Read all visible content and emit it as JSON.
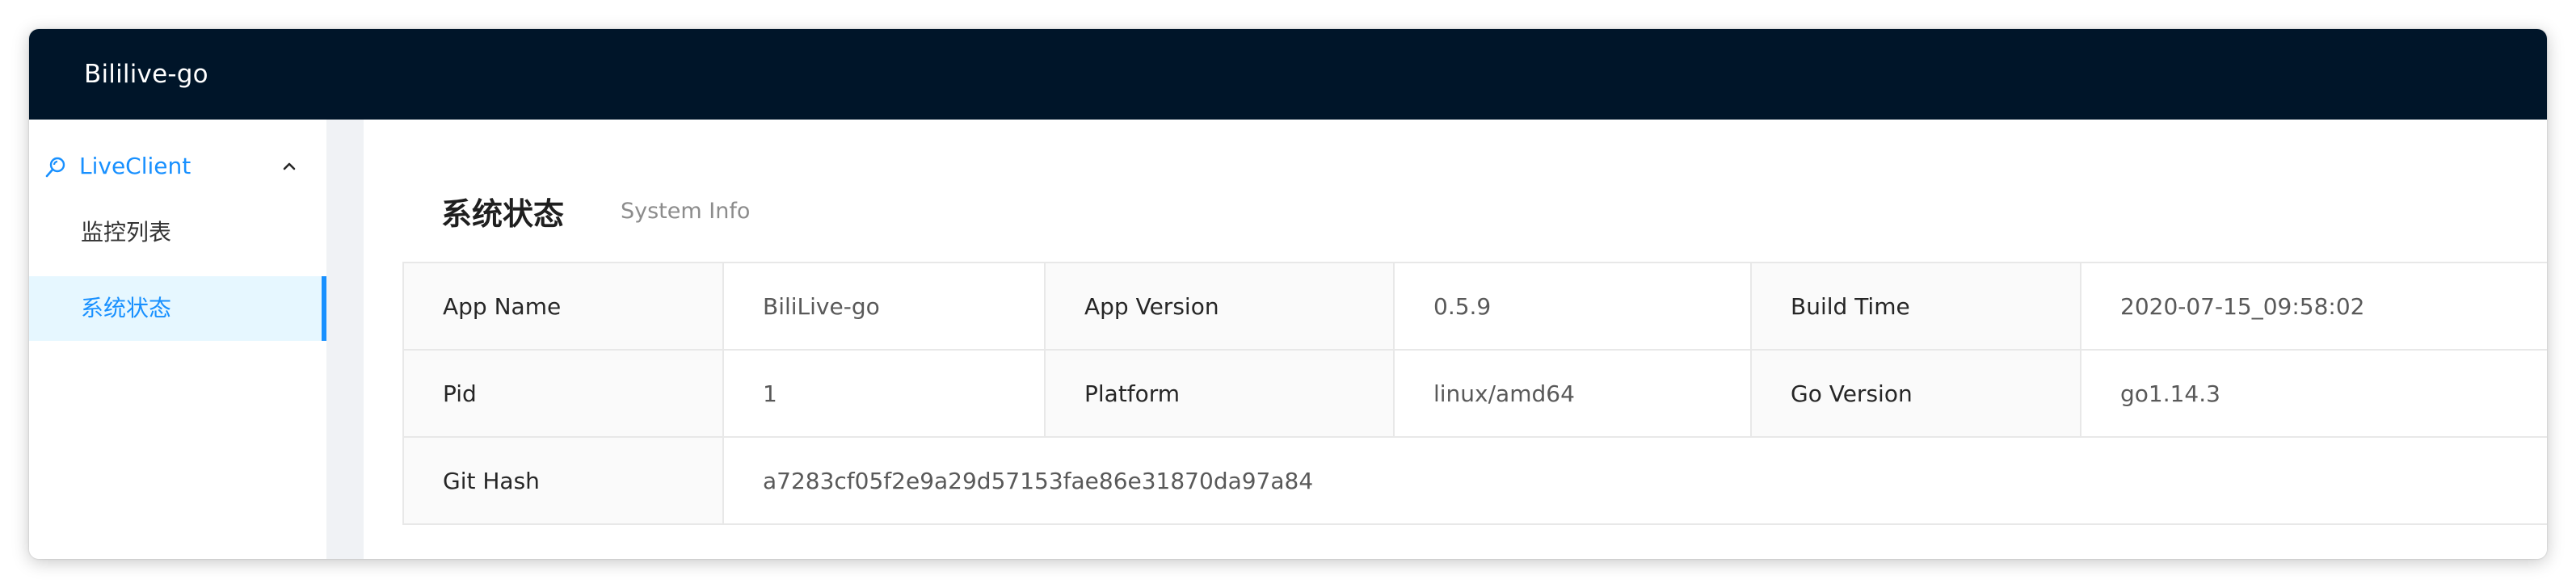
{
  "header": {
    "app_title": "Bililive-go"
  },
  "sidebar": {
    "group": {
      "label": "LiveClient",
      "icon": "live-client-icon",
      "expanded": true
    },
    "items": [
      {
        "label": "监控列表",
        "selected": false
      },
      {
        "label": "系统状态",
        "selected": true
      }
    ]
  },
  "main": {
    "title": "系统状态",
    "subtitle": "System Info",
    "info": {
      "rows": [
        [
          {
            "label": "App Name",
            "value": "BiliLive-go"
          },
          {
            "label": "App Version",
            "value": "0.5.9"
          },
          {
            "label": "Build Time",
            "value": "2020-07-15_09:58:02"
          }
        ],
        [
          {
            "label": "Pid",
            "value": "1"
          },
          {
            "label": "Platform",
            "value": "linux/amd64"
          },
          {
            "label": "Go Version",
            "value": "go1.14.3"
          }
        ],
        [
          {
            "label": "Git Hash",
            "value": "a7283cf05f2e9a29d57153fae86e31870da97a84"
          }
        ]
      ]
    }
  },
  "colors": {
    "header_bg": "#001529",
    "accent": "#1890ff",
    "selected_bg": "#e6f7ff",
    "label_cell_bg": "#fafafa",
    "border": "#e8e8e8"
  }
}
